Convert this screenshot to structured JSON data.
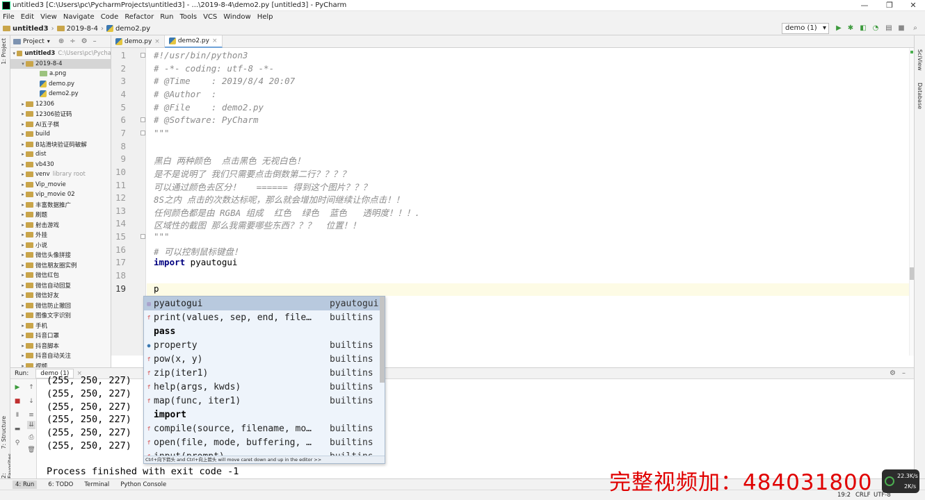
{
  "window": {
    "title": "untitled3 [C:\\Users\\pc\\PycharmProjects\\untitled3] - ...\\2019-8-4\\demo2.py [untitled3] - PyCharm",
    "min": "—",
    "max": "❐",
    "close": "✕"
  },
  "menu": [
    "File",
    "Edit",
    "View",
    "Navigate",
    "Code",
    "Refactor",
    "Run",
    "Tools",
    "VCS",
    "Window",
    "Help"
  ],
  "breadcrumb": [
    "untitled3",
    "2019-8-4",
    "demo2.py"
  ],
  "run_config": "demo (1)",
  "project": {
    "header": "Project",
    "items": [
      {
        "label": "untitled3",
        "hint": "C:\\Users\\pc\\Pycha",
        "kind": "folder",
        "arrow": "▾"
      },
      {
        "label": "2019-8-4",
        "hint": "",
        "kind": "folder",
        "arrow": "▾"
      },
      {
        "label": "a.png",
        "hint": "",
        "kind": "image",
        "arrow": ""
      },
      {
        "label": "demo.py",
        "hint": "",
        "kind": "py",
        "arrow": ""
      },
      {
        "label": "demo2.py",
        "hint": "",
        "kind": "py",
        "arrow": ""
      },
      {
        "label": "12306",
        "hint": "",
        "kind": "folder",
        "arrow": "▸"
      },
      {
        "label": "12306验证码",
        "hint": "",
        "kind": "folder",
        "arrow": "▸"
      },
      {
        "label": "AI五子棋",
        "hint": "",
        "kind": "folder",
        "arrow": "▸"
      },
      {
        "label": "build",
        "hint": "",
        "kind": "folder",
        "arrow": "▸"
      },
      {
        "label": "B站滑块验证码破解",
        "hint": "",
        "kind": "folder",
        "arrow": "▸"
      },
      {
        "label": "dist",
        "hint": "",
        "kind": "folder",
        "arrow": "▸"
      },
      {
        "label": "vb430",
        "hint": "",
        "kind": "folder",
        "arrow": "▸"
      },
      {
        "label": "venv",
        "hint": "library root",
        "kind": "folder",
        "arrow": "▸"
      },
      {
        "label": "Vip_movie",
        "hint": "",
        "kind": "folder",
        "arrow": "▸"
      },
      {
        "label": "vip_movie 02",
        "hint": "",
        "kind": "folder",
        "arrow": "▸"
      },
      {
        "label": "丰富数据推广",
        "hint": "",
        "kind": "folder",
        "arrow": "▸"
      },
      {
        "label": "刷题",
        "hint": "",
        "kind": "folder",
        "arrow": "▸"
      },
      {
        "label": "射击游戏",
        "hint": "",
        "kind": "folder",
        "arrow": "▸"
      },
      {
        "label": "外挂",
        "hint": "",
        "kind": "folder",
        "arrow": "▸"
      },
      {
        "label": "小说",
        "hint": "",
        "kind": "folder",
        "arrow": "▸"
      },
      {
        "label": "微信头像拼接",
        "hint": "",
        "kind": "folder",
        "arrow": "▸"
      },
      {
        "label": "微信朋友圈实例",
        "hint": "",
        "kind": "folder",
        "arrow": "▸"
      },
      {
        "label": "微信红包",
        "hint": "",
        "kind": "folder",
        "arrow": "▸"
      },
      {
        "label": "微信自动回复",
        "hint": "",
        "kind": "folder",
        "arrow": "▸"
      },
      {
        "label": "微信好友",
        "hint": "",
        "kind": "folder",
        "arrow": "▸"
      },
      {
        "label": "微信防止撤回",
        "hint": "",
        "kind": "folder",
        "arrow": "▸"
      },
      {
        "label": "图像文字识别",
        "hint": "",
        "kind": "folder",
        "arrow": "▸"
      },
      {
        "label": "手机",
        "hint": "",
        "kind": "folder",
        "arrow": "▸"
      },
      {
        "label": "抖音口罩",
        "hint": "",
        "kind": "folder",
        "arrow": "▸"
      },
      {
        "label": "抖音脚本",
        "hint": "",
        "kind": "folder",
        "arrow": "▸"
      },
      {
        "label": "抖音自动关注",
        "hint": "",
        "kind": "folder",
        "arrow": "▸"
      },
      {
        "label": "视频",
        "hint": "",
        "kind": "folder",
        "arrow": "▸"
      }
    ]
  },
  "tabs": [
    {
      "label": "demo.py",
      "active": false
    },
    {
      "label": "demo2.py",
      "active": true
    }
  ],
  "code_lines": [
    {
      "n": "1",
      "t": "#!/usr/bin/python3",
      "c": "cmt"
    },
    {
      "n": "2",
      "t": "# -*- coding: utf-8 -*-",
      "c": "cmt"
    },
    {
      "n": "3",
      "t": "# @Time    : 2019/8/4 20:07",
      "c": "cmt"
    },
    {
      "n": "4",
      "t": "# @Author  :",
      "c": "cmt"
    },
    {
      "n": "5",
      "t": "# @File    : demo2.py",
      "c": "cmt"
    },
    {
      "n": "6",
      "t": "# @Software: PyCharm",
      "c": "cmt"
    },
    {
      "n": "7",
      "t": "\"\"\"",
      "c": "cmt"
    },
    {
      "n": "8",
      "t": "",
      "c": "cmt"
    },
    {
      "n": "9",
      "t": "黑白 两种颜色  点击黑色 无视白色！",
      "c": "cmt"
    },
    {
      "n": "10",
      "t": "是不是说明了 我们只需要点击倒数第二行？？？？",
      "c": "cmt"
    },
    {
      "n": "11",
      "t": "可以通过颜色去区分！   ====== 得到这个图片？？？",
      "c": "cmt"
    },
    {
      "n": "12",
      "t": "8S之内 点击的次数达标呢，那么就会增加时间继续让你点击！！",
      "c": "cmt"
    },
    {
      "n": "13",
      "t": "任何颜色都是由 RGBA 组成  红色  绿色  蓝色   透明度！！！.",
      "c": "cmt"
    },
    {
      "n": "14",
      "t": "区域性的截图 那么我需要哪些东西？？？  位置！！",
      "c": "cmt"
    },
    {
      "n": "15",
      "t": "\"\"\"",
      "c": "cmt"
    },
    {
      "n": "16",
      "t": "# 可以控制鼠标键盘！",
      "c": "cmt"
    },
    {
      "n": "17",
      "t": "import pyautogui",
      "c": "import"
    },
    {
      "n": "18",
      "t": "",
      "c": "plain"
    },
    {
      "n": "19",
      "t": "p",
      "c": "plain"
    }
  ],
  "completion": {
    "items": [
      {
        "name": "pyautogui",
        "type": "pyautogui",
        "bold": false,
        "sel": true,
        "icon": "pkg"
      },
      {
        "name": "print(values, sep, end, file…",
        "type": "builtins",
        "bold": false,
        "sel": false,
        "icon": "f"
      },
      {
        "name": "pass",
        "type": "",
        "bold": true,
        "sel": false,
        "icon": ""
      },
      {
        "name": "property",
        "type": "builtins",
        "bold": false,
        "sel": false,
        "icon": "c"
      },
      {
        "name": "pow(x, y)",
        "type": "builtins",
        "bold": false,
        "sel": false,
        "icon": "f"
      },
      {
        "name": "zip(iter1)",
        "type": "builtins",
        "bold": false,
        "sel": false,
        "icon": "f"
      },
      {
        "name": "help(args, kwds)",
        "type": "builtins",
        "bold": false,
        "sel": false,
        "icon": "f"
      },
      {
        "name": "map(func, iter1)",
        "type": "builtins",
        "bold": false,
        "sel": false,
        "icon": "f"
      },
      {
        "name": "import",
        "type": "",
        "bold": true,
        "sel": false,
        "icon": ""
      },
      {
        "name": "compile(source, filename, mo…",
        "type": "builtins",
        "bold": false,
        "sel": false,
        "icon": "f"
      },
      {
        "name": "open(file, mode, buffering, …",
        "type": "builtins",
        "bold": false,
        "sel": false,
        "icon": "f"
      },
      {
        "name": "input(prompt)",
        "type": "builtins",
        "bold": false,
        "sel": false,
        "icon": "f"
      }
    ],
    "hint": "Ctrl+向下箭头 and Ctrl+向上箭头 will move caret down and up in the editor  >>"
  },
  "run": {
    "tab_run": "Run:",
    "tab_config": "demo (1)",
    "output": [
      "(255, 250, 227)",
      "(255, 250, 227)",
      "(255, 250, 227)",
      "(255, 250, 227)",
      "(255, 250, 227)",
      "(255, 250, 227)"
    ],
    "finish": "Process finished with exit code -1"
  },
  "bottom_tabs": [
    "4: Run",
    "6: TODO",
    "Terminal",
    "Python Console"
  ],
  "status": {
    "position": "19:2",
    "crlf": "CRLF",
    "encoding": "UTF-8"
  },
  "left_strip": {
    "project": "1: Project",
    "structure": "7: Structure",
    "favorites": "2: Favorites"
  },
  "right_strip": {
    "sciview": "SciView",
    "database": "Database"
  },
  "watermark": "完整视频加：484031800",
  "net": {
    "up": "22.3K/s",
    "down": "2K/s"
  },
  "colors": {
    "accent": "#6fa3d8",
    "comment": "#8c8c8c",
    "keyword": "#000080",
    "watermark": "#e00000"
  }
}
